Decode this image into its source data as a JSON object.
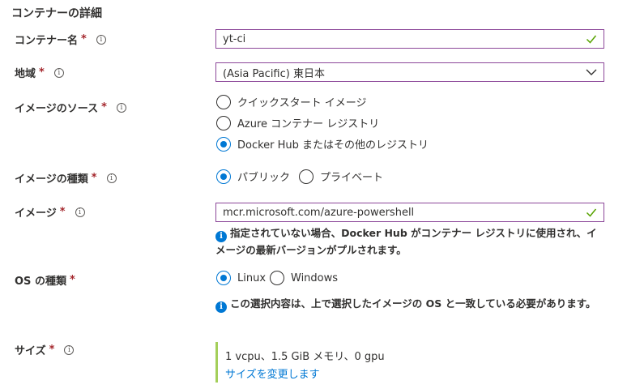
{
  "section_title": "コンテナーの詳細",
  "required_mark": "*",
  "info_glyph": "i",
  "fields": {
    "container_name": {
      "label": "コンテナー名",
      "value": "yt-ci"
    },
    "region": {
      "label": "地域",
      "value": "(Asia Pacific) 東日本"
    },
    "image_source": {
      "label": "イメージのソース",
      "options": [
        {
          "label": "クイックスタート イメージ",
          "selected": false
        },
        {
          "label": "Azure コンテナー レジストリ",
          "selected": false
        },
        {
          "label": "Docker Hub またはその他のレジストリ",
          "selected": true
        }
      ]
    },
    "image_type": {
      "label": "イメージの種類",
      "options": [
        {
          "label": "パブリック",
          "selected": true
        },
        {
          "label": "プライベート",
          "selected": false
        }
      ]
    },
    "image": {
      "label": "イメージ",
      "value": "mcr.microsoft.com/azure-powershell",
      "info": "指定されていない場合、Docker Hub がコンテナー レジストリに使用され、イメージの最新バージョンがプルされます。"
    },
    "os_type": {
      "label": "OS の種類",
      "options": [
        {
          "label": "Linux",
          "selected": true
        },
        {
          "label": "Windows",
          "selected": false
        }
      ],
      "info": "この選択内容は、上で選択したイメージの OS と一致している必要があります。"
    },
    "size": {
      "label": "サイズ",
      "value": "1 vcpu、1.5 GiB メモリ、0 gpu",
      "change_link": "サイズを変更します"
    }
  },
  "colors": {
    "accent": "#0078d4",
    "valid_check": "#57a300",
    "required": "#a4262c",
    "focus_border": "#8c4799",
    "size_bar": "#a4cf5a"
  }
}
